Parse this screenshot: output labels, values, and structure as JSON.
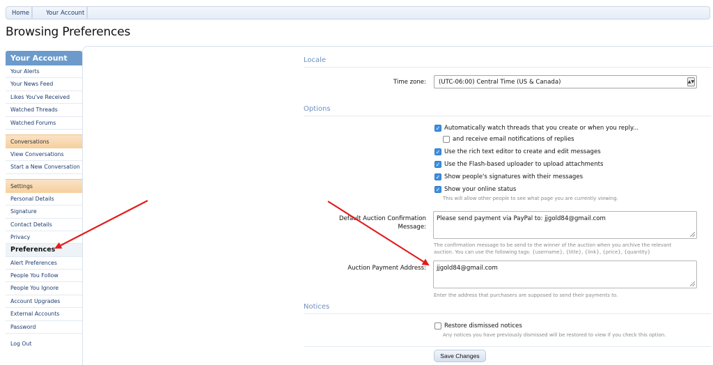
{
  "breadcrumb": [
    "Home",
    "Your Account"
  ],
  "page_title": "Browsing Preferences",
  "sidebar": {
    "header": "Your Account",
    "group1": [
      "Your Alerts",
      "Your News Feed",
      "Likes You've Received",
      "Watched Threads",
      "Watched Forums"
    ],
    "conversations_title": "Conversations",
    "group2": [
      "View Conversations",
      "Start a New Conversation"
    ],
    "settings_title": "Settings",
    "group3": [
      "Personal Details",
      "Signature",
      "Contact Details",
      "Privacy",
      "Preferences",
      "Alert Preferences",
      "People You Follow",
      "People You Ignore",
      "Account Upgrades",
      "External Accounts",
      "Password"
    ],
    "logout": "Log Out"
  },
  "locale": {
    "title": "Locale",
    "timezone_label": "Time zone:",
    "timezone_value": "(UTC-06:00) Central Time (US & Canada)"
  },
  "options": {
    "title": "Options",
    "items": [
      {
        "label": "Automatically watch threads that you create or when you reply...",
        "checked": true
      },
      {
        "label": "and receive email notifications of replies",
        "checked": false
      },
      {
        "label": "Use the rich text editor to create and edit messages",
        "checked": true
      },
      {
        "label": "Use the Flash-based uploader to upload attachments",
        "checked": true
      },
      {
        "label": "Show people's signatures with their messages",
        "checked": true
      },
      {
        "label": "Show your online status",
        "checked": true
      }
    ],
    "online_hint": "This will allow other people to see what page you are currently viewing.",
    "confirm_label_1": "Default Auction Confirmation",
    "confirm_label_2": "Message:",
    "confirm_value": "Please send payment via PayPal to: jjgold84@gmail.com",
    "confirm_hint_1": "The confirmation message to be send to the winner of the auction when you archive the relevant",
    "confirm_hint_2": "auction. You can use the following tags: {username}, {title}, {link}, {price}, {quantity}",
    "payment_label": "Auction Payment Address:",
    "payment_value": "jjgold84@gmail.com",
    "payment_hint": "Enter the address that purchasers are supposed to send their payments to."
  },
  "notices": {
    "title": "Notices",
    "restore_label": "Restore dismissed notices",
    "restore_hint": "Any notices you have previously dismissed will be restored to view if you check this option."
  },
  "save_label": "Save Changes",
  "colors": {
    "accent": "#6c9bcb",
    "annotation_arrow": "#e31b1b"
  }
}
